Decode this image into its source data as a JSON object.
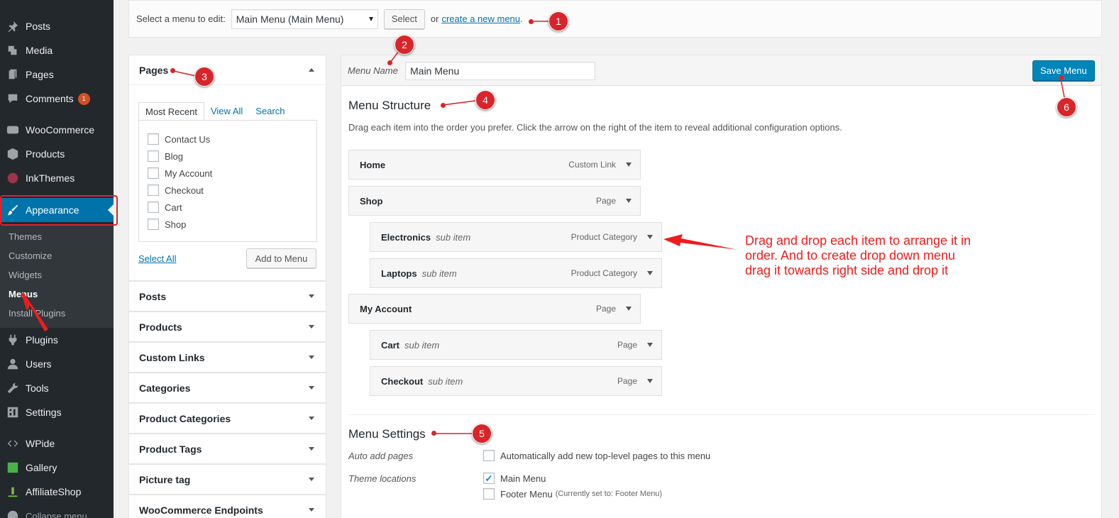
{
  "sidebar": {
    "items": [
      {
        "label": "Posts",
        "icon": "pin-icon"
      },
      {
        "label": "Media",
        "icon": "media-icon"
      },
      {
        "label": "Pages",
        "icon": "pages-icon"
      },
      {
        "label": "Comments",
        "icon": "comment-icon",
        "badge": "1"
      },
      {
        "label": "WooCommerce",
        "icon": "woocommerce-icon"
      },
      {
        "label": "Products",
        "icon": "box-icon"
      },
      {
        "label": "InkThemes",
        "icon": "inkthemes-icon"
      },
      {
        "label": "Appearance",
        "icon": "paintbrush-icon"
      },
      {
        "label": "Plugins",
        "icon": "plug-icon"
      },
      {
        "label": "Users",
        "icon": "user-icon"
      },
      {
        "label": "Tools",
        "icon": "wrench-icon"
      },
      {
        "label": "Settings",
        "icon": "settings-icon"
      },
      {
        "label": "WPide",
        "icon": "code-icon"
      },
      {
        "label": "Gallery",
        "icon": "gallery-icon"
      },
      {
        "label": "AffiliateShop",
        "icon": "affiliate-icon"
      }
    ],
    "submenu": [
      "Themes",
      "Customize",
      "Widgets",
      "Menus",
      "Install Plugins"
    ],
    "collapse_label": "Collapse menu"
  },
  "topbar": {
    "select_label": "Select a menu to edit:",
    "selected_menu": "Main Menu (Main Menu)",
    "select_button": "Select",
    "or_text": "or",
    "create_link": "create a new menu",
    "period": "."
  },
  "pages_box": {
    "title": "Pages",
    "tabs": [
      "Most Recent",
      "View All",
      "Search"
    ],
    "pages": [
      "Contact Us",
      "Blog",
      "My Account",
      "Checkout",
      "Cart",
      "Shop"
    ],
    "select_all": "Select All",
    "add_button": "Add to Menu"
  },
  "accordions": [
    "Posts",
    "Products",
    "Custom Links",
    "Categories",
    "Product Categories",
    "Product Tags",
    "Picture tag",
    "WooCommerce Endpoints"
  ],
  "menu_panel": {
    "name_label": "Menu Name",
    "name_value": "Main Menu",
    "save_button": "Save Menu",
    "structure_title": "Menu Structure",
    "structure_desc": "Drag each item into the order you prefer. Click the arrow on the right of the item to reveal additional configuration options.",
    "items": [
      {
        "title": "Home",
        "sub": "",
        "type": "Custom Link"
      },
      {
        "title": "Shop",
        "sub": "",
        "type": "Page"
      },
      {
        "title": "Electronics",
        "sub": "sub item",
        "type": "Product Category"
      },
      {
        "title": "Laptops",
        "sub": "sub item",
        "type": "Product Category"
      },
      {
        "title": "My Account",
        "sub": "",
        "type": "Page"
      },
      {
        "title": "Cart",
        "sub": "sub item",
        "type": "Page"
      },
      {
        "title": "Checkout",
        "sub": "sub item",
        "type": "Page"
      }
    ],
    "settings_title": "Menu Settings",
    "auto_add_label": "Auto add pages",
    "auto_add_text": "Automatically add new top-level pages to this menu",
    "locations_label": "Theme locations",
    "location_main": "Main Menu",
    "location_footer": "Footer Menu",
    "location_footer_note": "(Currently set to: Footer Menu)"
  },
  "annotations": {
    "numbers": [
      "1",
      "2",
      "3",
      "4",
      "5",
      "6"
    ],
    "callout": "Drag and drop each item to arrange it in order. And to create drop down menu drag it towards right side and drop it"
  },
  "colors": {
    "sidebar_bg": "#23282d",
    "accent": "#0073aa",
    "annotation_red": "#d9252a"
  }
}
